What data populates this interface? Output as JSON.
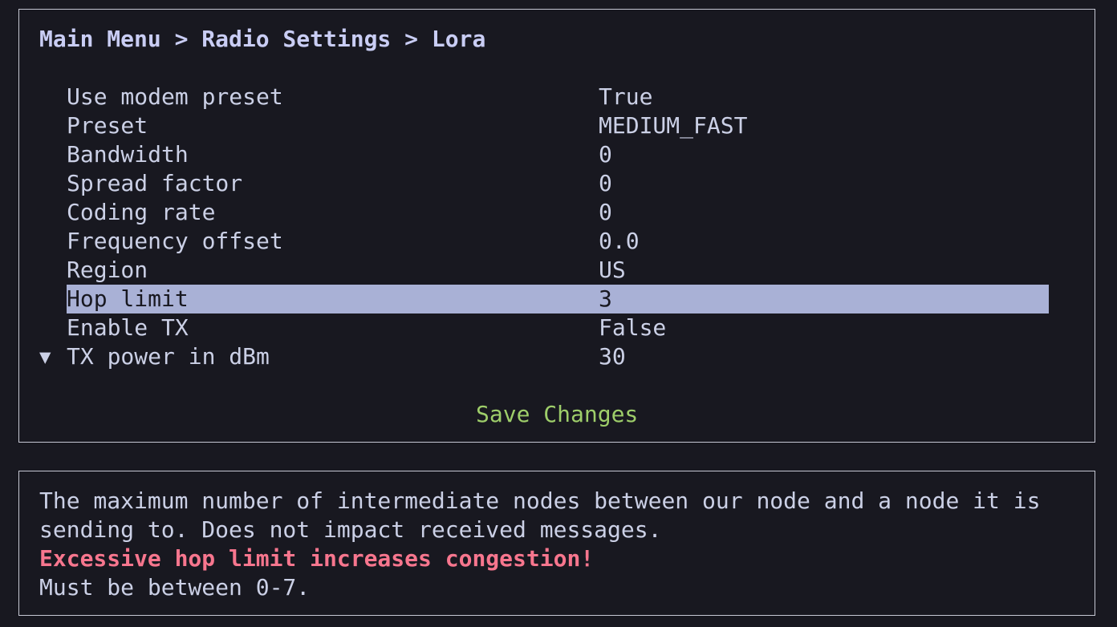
{
  "breadcrumb": "Main Menu > Radio Settings > Lora",
  "settings": [
    {
      "label": "Use modem preset",
      "value": "True"
    },
    {
      "label": "Preset",
      "value": "MEDIUM_FAST"
    },
    {
      "label": "Bandwidth",
      "value": "0"
    },
    {
      "label": "Spread factor",
      "value": "0"
    },
    {
      "label": "Coding rate",
      "value": "0"
    },
    {
      "label": "Frequency offset",
      "value": "0.0"
    },
    {
      "label": "Region",
      "value": "US"
    },
    {
      "label": "Hop limit",
      "value": "3"
    },
    {
      "label": "Enable TX",
      "value": "False"
    },
    {
      "label": "TX power in dBm",
      "value": "30"
    }
  ],
  "selected_setting": "Hop limit",
  "scroll_indicator": "▼",
  "save_label": "Save Changes",
  "help": {
    "line1": "The maximum number of intermediate nodes between our node and a node it is",
    "line2": "sending to. Does not impact received messages.",
    "warning": "Excessive hop limit increases congestion!",
    "constraint": "Must be between 0-7."
  },
  "colors": {
    "background": "#181820",
    "text": "#cbd0e6",
    "highlight": "#a9b1d6",
    "save": "#9ece6a",
    "warning": "#f7768e"
  }
}
